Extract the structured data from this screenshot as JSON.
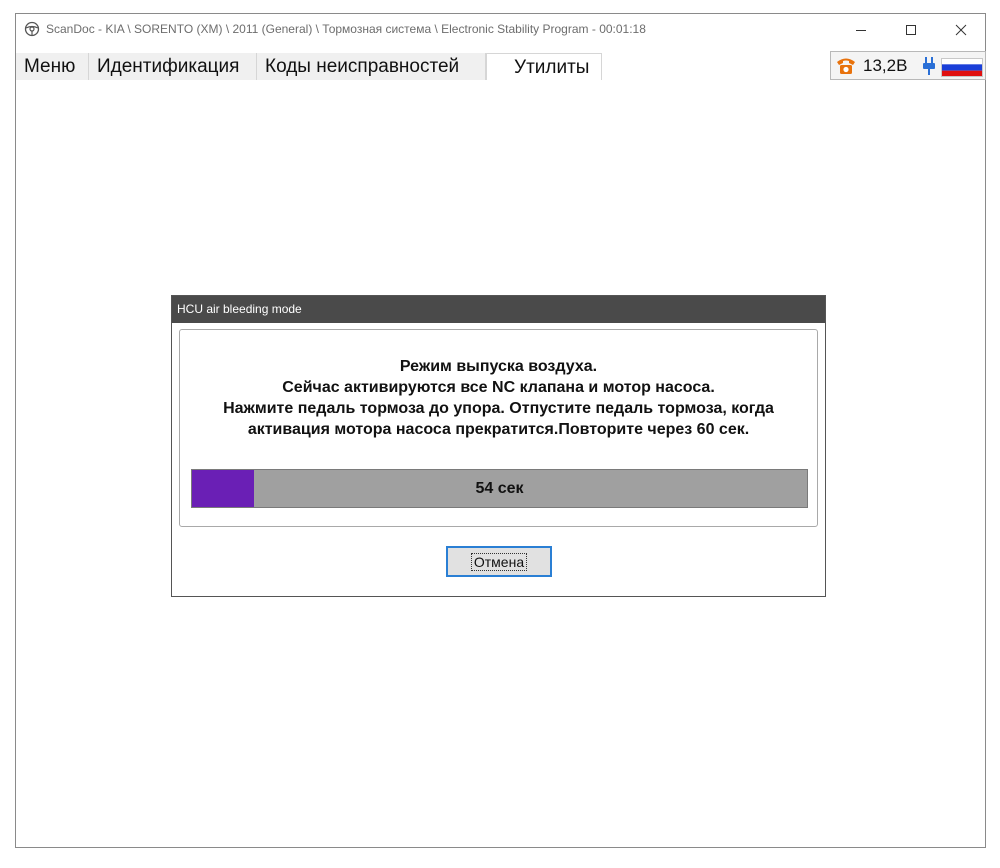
{
  "window": {
    "title": "ScanDoc - KIA \\ SORENTO (XM) \\ 2011 (General) \\ Тормозная система \\ Electronic Stability Program - 00:01:18",
    "controls": {
      "minimize_icon": "minimize-icon",
      "maximize_icon": "maximize-icon",
      "close_icon": "close-icon"
    }
  },
  "menu": {
    "tabs": [
      {
        "label": "Меню"
      },
      {
        "label": "Идентификация"
      },
      {
        "label": "Коды неисправностей"
      },
      {
        "label": "Утилиты",
        "active": true
      }
    ]
  },
  "status": {
    "voltage": "13,2В",
    "phone_icon_color": "#e8720c",
    "plug_icon_color": "#2a6fd6",
    "flag_colors": [
      "#ffffff",
      "#1a3fd8",
      "#e01010"
    ]
  },
  "dialog": {
    "title": "HCU air bleeding mode",
    "message_lines": [
      "Режим выпуска воздуха.",
      "Сейчас активируются все NC клапана и мотор насоса.",
      "Нажмите педаль тормоза до упора. Отпустите педаль тормоза, когда",
      "активация мотора насоса прекратится.Повторите через 60 сек."
    ],
    "progress": {
      "label": "54 сек",
      "fraction": 0.1,
      "fill_color": "#6a1fb5",
      "track_color": "#a0a0a0"
    },
    "cancel_label": "Отмена"
  }
}
